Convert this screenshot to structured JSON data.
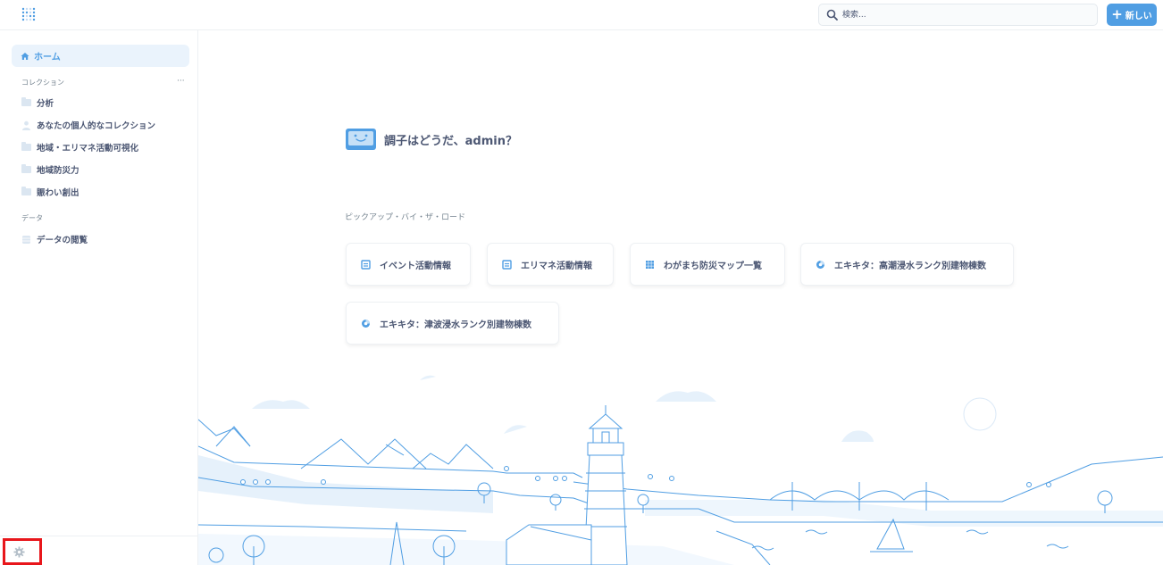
{
  "header": {
    "search_placeholder": "検索...",
    "new_button_label": "新しい",
    "colors": {
      "accent": "#509ee3"
    }
  },
  "sidebar": {
    "home_label": "ホーム",
    "collections_label": "コレクション",
    "collections_more": "···",
    "collections": [
      {
        "label": "分析",
        "icon": "folder-icon"
      },
      {
        "label": "あなたの個人的なコレクション",
        "icon": "person-icon"
      },
      {
        "label": "地域・エリマネ活動可視化",
        "icon": "folder-icon"
      },
      {
        "label": "地域防災力",
        "icon": "folder-icon"
      },
      {
        "label": "賑わい創出",
        "icon": "folder-icon"
      }
    ],
    "data_label": "データ",
    "data_items": [
      {
        "label": "データの閲覧",
        "icon": "database-icon"
      }
    ],
    "settings_icon": "gear-icon"
  },
  "main": {
    "greeting": "調子はどうだ、admin？",
    "pickup_label": "ピックアップ・バイ・ザ・ロード",
    "cards": [
      {
        "label": "イベント活動情報",
        "icon": "table-icon"
      },
      {
        "label": "エリマネ活動情報",
        "icon": "table-icon"
      },
      {
        "label": "わがまち防災マップ一覧",
        "icon": "grid-icon"
      },
      {
        "label": "エキキタ：高潮浸水ランク別建物棟数",
        "icon": "pie-icon"
      },
      {
        "label": "エキキタ：津波浸水ランク別建物棟数",
        "icon": "pie-icon"
      }
    ]
  }
}
